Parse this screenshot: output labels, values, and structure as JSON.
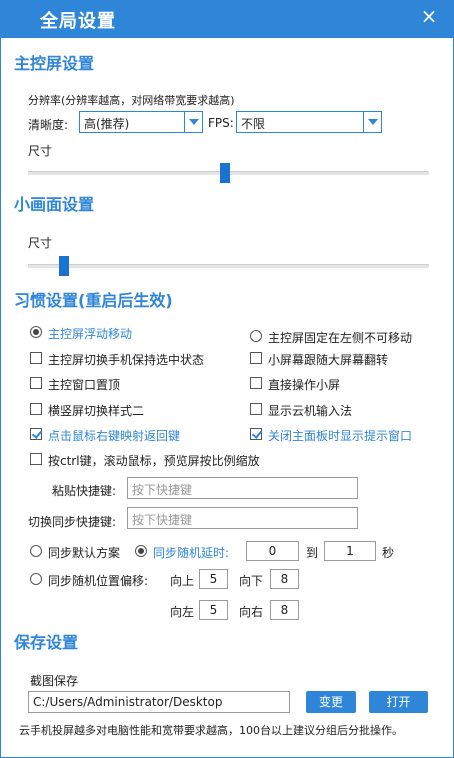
{
  "window": {
    "title": "全局设置",
    "close": "×"
  },
  "main_screen": {
    "section_title": "主控屏设置",
    "resolution_hint": "分辨率(分辨率越高，对网络带宽要求越高)",
    "clarity_label": "清晰度:",
    "clarity_value": "高(推荐)",
    "fps_label": "FPS:",
    "fps_value": "不限",
    "size_label": "尺寸",
    "size_level": 0.49
  },
  "small_screen": {
    "section_title": "小画面设置",
    "size_label": "尺寸",
    "size_level": 0.08
  },
  "habits": {
    "section_title": "习惯设置(重启后生效)",
    "radio_float": "主控屏浮动移动",
    "radio_fixed": "主控屏固定在左侧不可移动",
    "cb_keep_selected": "主控屏切换手机保持选中状态",
    "cb_follow_flip": "小屏幕跟随大屏幕翻转",
    "cb_topmost": "主控窗口置顶",
    "cb_direct_op": "直接操作小屏",
    "cb_style2": "横竖屏切换样式二",
    "cb_show_ime": "显示云机输入法",
    "cb_right_click_back": "点击鼠标右键映射返回键",
    "cb_close_tip": "关闭主面板时显示提示窗口",
    "cb_ctrl_zoom": "按ctrl键，滚动鼠标，预览屏按比例缩放",
    "paste_hotkey_label": "粘贴快捷键:",
    "paste_hotkey_placeholder": "按下快捷键",
    "sync_hotkey_label": "切换同步快捷键:",
    "sync_hotkey_placeholder": "按下快捷键",
    "sync_default": "同步默认方案",
    "sync_random_delay": "同步随机延时:",
    "delay_from": "0",
    "delay_to_label": "到",
    "delay_to": "1",
    "delay_unit": "秒",
    "sync_random_offset": "同步随机位置偏移:",
    "up_label": "向上",
    "up_value": "5",
    "down_label": "向下",
    "down_value": "8",
    "left_label": "向左",
    "left_value": "5",
    "right_label": "向右",
    "right_value": "8"
  },
  "save": {
    "section_title": "保存设置",
    "screenshot_label": "截图保存",
    "path": "C:/Users/Administrator/Desktop",
    "change_button": "变更",
    "open_button": "打开",
    "footer_note": "云手机投屏越多对电脑性能和宽带要求越高，100台以上建议分组后分批操作。"
  },
  "colors": {
    "accent": "#2f86d9",
    "slider_thumb": "#1a73d1"
  }
}
